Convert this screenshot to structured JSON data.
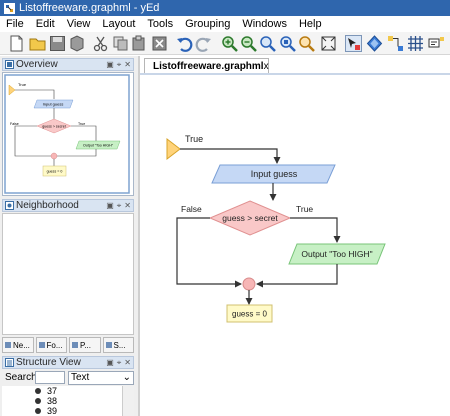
{
  "window": {
    "title": "Listoffreeware.graphml - yEd"
  },
  "menu": [
    "File",
    "Edit",
    "View",
    "Layout",
    "Tools",
    "Grouping",
    "Windows",
    "Help"
  ],
  "toolbar": {
    "buttons": [
      "new-icon",
      "open-icon",
      "save-icon",
      "save-as-icon",
      "cut-icon",
      "copy-icon",
      "paste-icon",
      "delete-icon",
      "undo-icon",
      "redo-icon",
      "zoom-in-icon",
      "zoom-out-icon",
      "zoom-100-icon",
      "zoom-fit-icon",
      "zoom-area-icon",
      "fit-content-icon",
      "selection-mode-icon",
      "layout-icon",
      "snap-icon",
      "grid-icon",
      "properties-icon"
    ]
  },
  "panels": {
    "overview": {
      "title": "Overview"
    },
    "neighborhood": {
      "title": "Neighborhood"
    },
    "neighborhood_tabs": [
      "Ne...",
      "Fo...",
      "P...",
      "S..."
    ],
    "structure": {
      "title": "Structure View",
      "search_label": "Search",
      "search_value": "",
      "filter_value": "Text",
      "items": [
        "37",
        "38",
        "39"
      ]
    }
  },
  "document": {
    "tab_label": "Listoffreeware.graphml",
    "close_glyph": "x"
  },
  "diagram": {
    "start_label": "True",
    "input_label": "Input guess",
    "decision_label": "guess > secret",
    "false_label": "False",
    "true_label": "True",
    "output_label": "Output \"Too HIGH\"",
    "assign_label": "guess = 0"
  },
  "colors": {
    "titlebar": "#2f66ad",
    "start_fill": "#ffd37a",
    "input_fill": "#c5d8f5",
    "decision_fill": "#f9c8c8",
    "output_fill": "#c7f0c5",
    "assign_fill": "#fffac8",
    "merge_fill": "#f7b6b6"
  }
}
